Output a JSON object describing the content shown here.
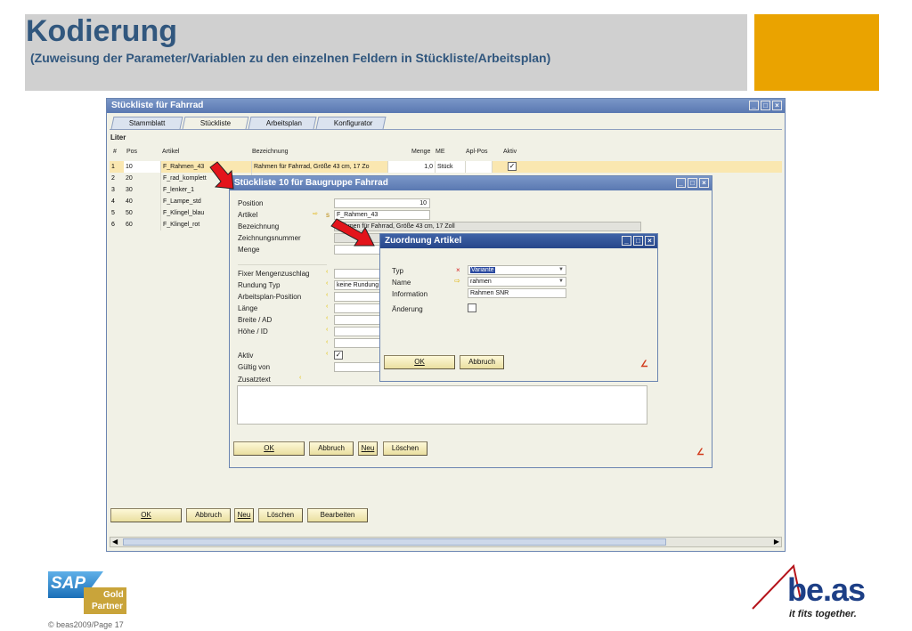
{
  "slide": {
    "title": "Kodierung",
    "subtitle": "(Zuweisung der Parameter/Variablen zu den einzelnen Feldern in Stückliste/Arbeitsplan)",
    "copyright": "© beas2009/Page 17",
    "sap_logo_text": "SAP",
    "gold_text": "Gold",
    "partner_text": "Partner",
    "beas_logo_text": "be.as",
    "beas_tagline": "it fits together."
  },
  "main_window": {
    "title": "Stückliste für Fahrrad",
    "tabs": [
      "Stammblatt",
      "Stückliste",
      "Arbeitsplan",
      "Konfigurator"
    ],
    "active_tab": "Stückliste",
    "unit_label": "Liter",
    "columns": [
      "#",
      "Pos",
      "Artikel",
      "Bezeichnung",
      "Menge",
      "ME",
      "Apl-Pos",
      "Aktiv"
    ],
    "rows": [
      {
        "num": "1",
        "pos": "10",
        "artikel": "F_Rahmen_43",
        "bezeichnung": "Rahmen für Fahrrad, Größe 43 cm, 17 Zo",
        "menge": "1,0",
        "me": "Stück",
        "aplpos": "",
        "aktiv": "✓"
      },
      {
        "num": "2",
        "pos": "20",
        "artikel": "F_rad_komplett",
        "bezeichnung": "",
        "menge": "",
        "me": "",
        "aplpos": "",
        "aktiv": ""
      },
      {
        "num": "3",
        "pos": "30",
        "artikel": "F_lenker_1",
        "bezeichnung": "",
        "menge": "",
        "me": "",
        "aplpos": "",
        "aktiv": ""
      },
      {
        "num": "4",
        "pos": "40",
        "artikel": "F_Lampe_std",
        "bezeichnung": "",
        "menge": "",
        "me": "",
        "aplpos": "",
        "aktiv": ""
      },
      {
        "num": "5",
        "pos": "50",
        "artikel": "F_Klingel_blau",
        "bezeichnung": "",
        "menge": "",
        "me": "",
        "aplpos": "",
        "aktiv": ""
      },
      {
        "num": "6",
        "pos": "60",
        "artikel": "F_Klingel_rot",
        "bezeichnung": "",
        "menge": "",
        "me": "",
        "aplpos": "",
        "aktiv": ""
      }
    ],
    "buttons": {
      "ok": "OK",
      "abbruch": "Abbruch",
      "neu": "Neu",
      "loeschen": "Löschen",
      "bearbeiten": "Bearbeiten"
    }
  },
  "bom_dialog": {
    "title": "Stückliste 10 für Baugruppe Fahrrad",
    "labels": {
      "position": "Position",
      "artikel": "Artikel",
      "bezeichnung": "Bezeichnung",
      "zeichnungsnummer": "Zeichnungsnummer",
      "menge": "Menge",
      "fixer": "Fixer Mengenzuschlag",
      "rundung": "Rundung Typ",
      "arbeitsplan": "Arbeitsplan-Position",
      "laenge": "Länge",
      "breite": "Breite / AD",
      "hoehe": "Höhe / ID",
      "aktiv": "Aktiv",
      "gueltig": "Gültig von",
      "zusatztext": "Zusatztext"
    },
    "values": {
      "position": "10",
      "artikel": "F_Rahmen_43",
      "bezeichnung": "Rahmen für Fahrrad, Größe 43 cm, 17 Zoll",
      "rundung": "keine Rundung",
      "aktiv": "✓",
      "artikel_marker": "s"
    },
    "buttons": {
      "ok": "OK",
      "abbruch": "Abbruch",
      "neu": "Neu",
      "loeschen": "Löschen"
    }
  },
  "assign_dialog": {
    "title": "Zuordnung Artikel",
    "labels": {
      "typ": "Typ",
      "name": "Name",
      "information": "Information",
      "aenderung": "Änderung"
    },
    "values": {
      "typ": "Variante",
      "name": "rahmen",
      "information": "Rahmen SNR"
    },
    "buttons": {
      "ok": "OK",
      "abbruch": "Abbruch"
    }
  },
  "colors": {
    "accent": "#eaa300",
    "title_blue": "#31577e",
    "header_gray": "#d0d0d0",
    "arrow_red": "#e3141b"
  }
}
